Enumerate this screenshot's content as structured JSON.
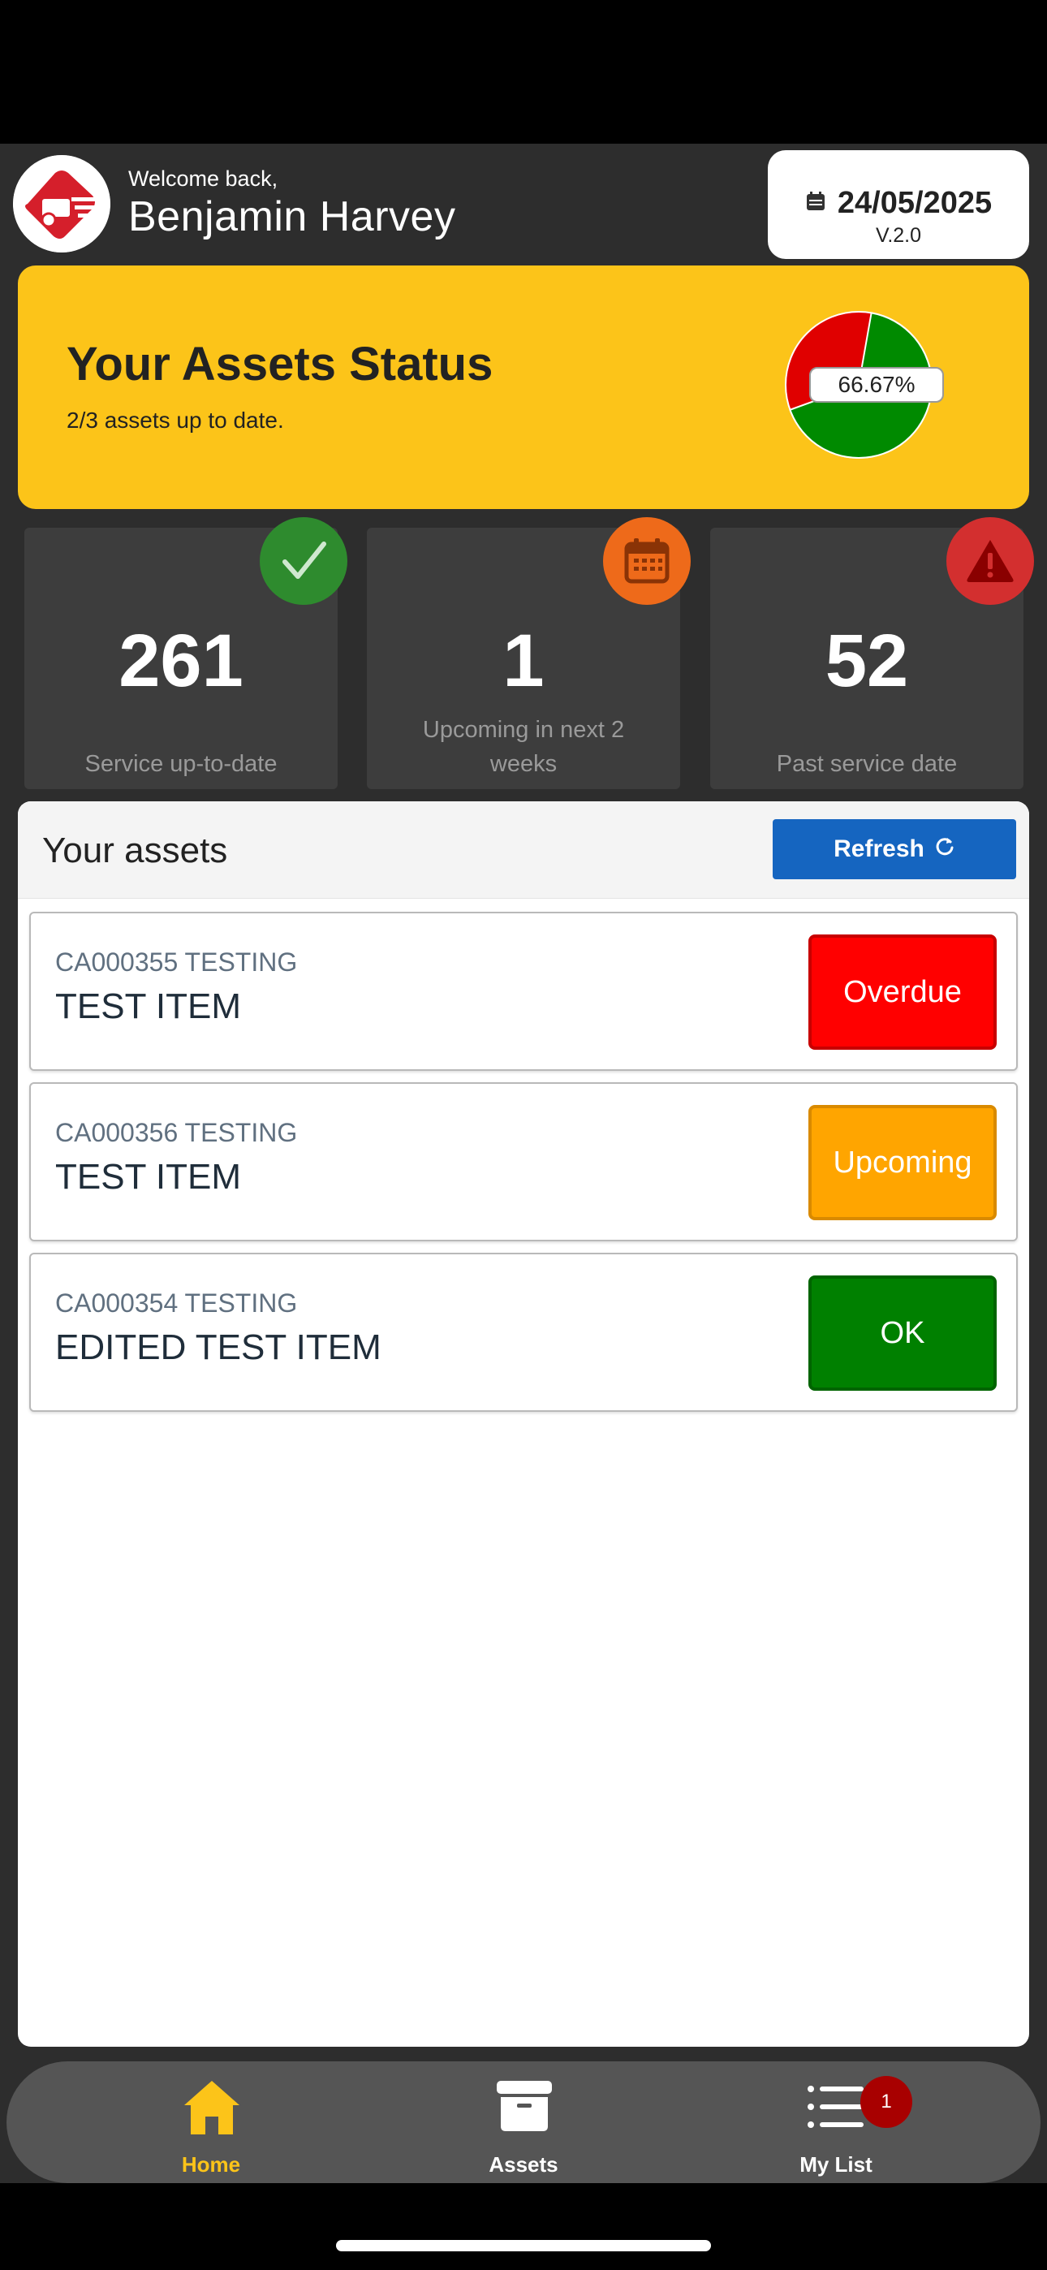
{
  "header": {
    "welcome": "Welcome back,",
    "user_name": "Benjamin Harvey",
    "date": "24/05/2025",
    "version": "V.2.0"
  },
  "status": {
    "title": "Your Assets Status",
    "description": "2/3 assets up to date.",
    "percent_label": "66.67%",
    "up_to_date_fraction": 0.6667
  },
  "stats": [
    {
      "value": "261",
      "label": "Service up-to-date",
      "icon": "check-icon",
      "color": "#2e8b2e"
    },
    {
      "value": "1",
      "label": "Upcoming in next 2 weeks",
      "icon": "calendar-icon",
      "color": "#ee6a1a"
    },
    {
      "value": "52",
      "label": "Past service date",
      "icon": "warning-icon",
      "color": "#d32f2f"
    }
  ],
  "assets_panel": {
    "title": "Your assets",
    "refresh_label": "Refresh"
  },
  "assets": [
    {
      "code": "CA000355 TESTING",
      "name": "TEST ITEM",
      "status": "Overdue",
      "color": "#ff0000"
    },
    {
      "code": "CA000356 TESTING",
      "name": "TEST ITEM",
      "status": "Upcoming",
      "color": "#ffa500"
    },
    {
      "code": "CA000354 TESTING",
      "name": "EDITED TEST ITEM",
      "status": "OK",
      "color": "#008000"
    }
  ],
  "nav": {
    "home": "Home",
    "assets": "Assets",
    "my_list": "My List",
    "my_list_badge": "1",
    "active_color": "#fcc419"
  }
}
